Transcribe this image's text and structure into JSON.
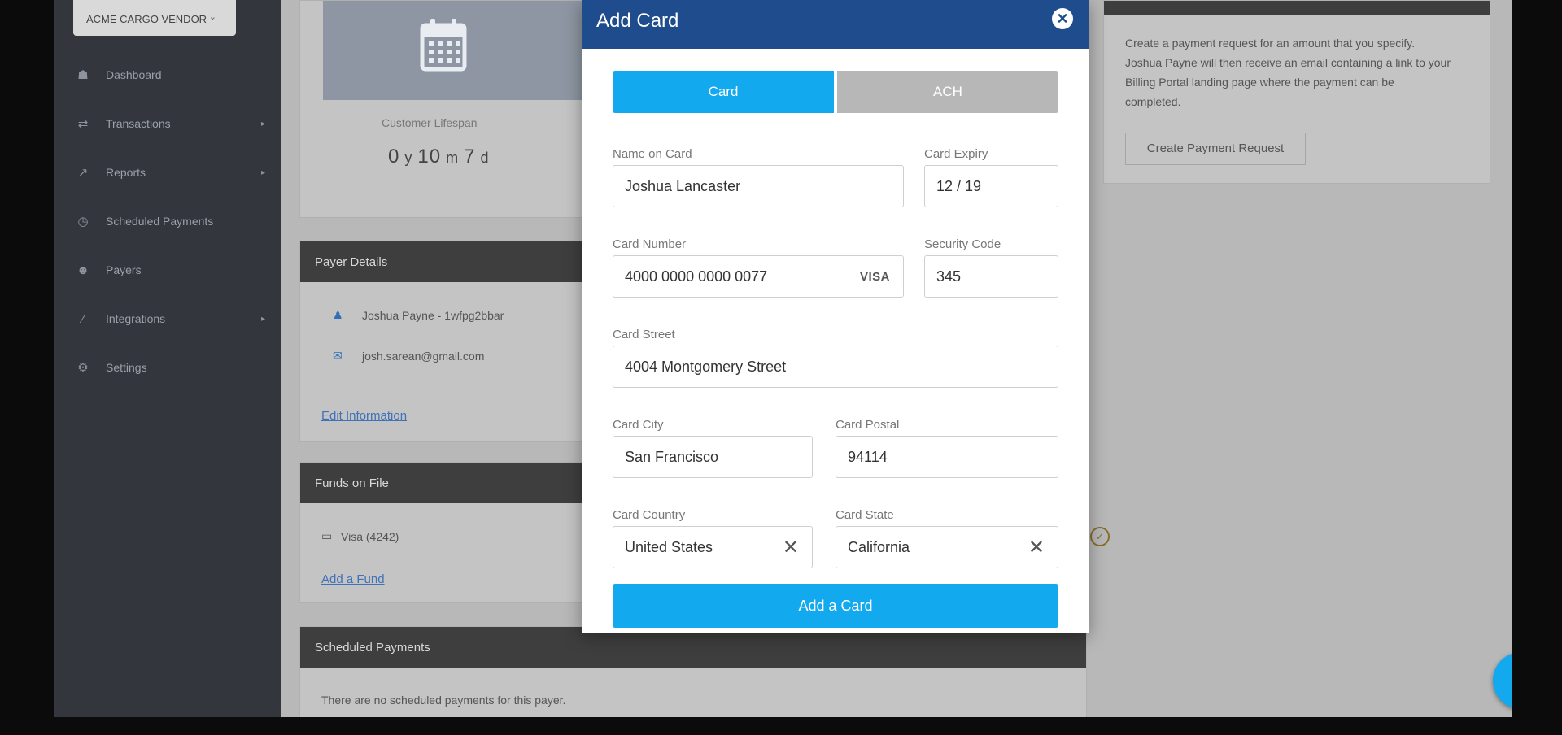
{
  "sidebar": {
    "vendor": "ACME CARGO VENDOR",
    "items": [
      {
        "label": "Dashboard",
        "icon": "dashboard-icon",
        "glyph": "☗",
        "arrow": false
      },
      {
        "label": "Transactions",
        "icon": "transactions-icon",
        "glyph": "⇄",
        "arrow": true
      },
      {
        "label": "Reports",
        "icon": "reports-icon",
        "glyph": "↗",
        "arrow": true
      },
      {
        "label": "Scheduled Payments",
        "icon": "clock-icon",
        "glyph": "◷",
        "arrow": false
      },
      {
        "label": "Payers",
        "icon": "payers-icon",
        "glyph": "☻",
        "arrow": false
      },
      {
        "label": "Integrations",
        "icon": "integrations-icon",
        "glyph": "⁄",
        "arrow": true
      },
      {
        "label": "Settings",
        "icon": "settings-icon",
        "glyph": "⚙",
        "arrow": false
      }
    ]
  },
  "main": {
    "lifespan_label": "Customer Lifespan",
    "lifespan_y": "0",
    "lifespan_m": "10",
    "lifespan_d": "7",
    "payer_details": {
      "title": "Payer Details",
      "name": "Joshua Payne - 1wfpg2bbar",
      "email": "josh.sarean@gmail.com",
      "edit_link": "Edit Information"
    },
    "funds": {
      "title": "Funds on File",
      "card": "Visa (4242)",
      "add_link": "Add a Fund"
    },
    "scheduled": {
      "title": "Scheduled Payments",
      "empty": "There are no scheduled payments for this payer."
    }
  },
  "request_panel": {
    "text": "Create a payment request for an amount that you specify. Joshua Payne will then receive an email containing a link to your Billing Portal landing page where the payment can be completed.",
    "button": "Create Payment Request"
  },
  "modal": {
    "title": "Add Card",
    "tabs": [
      "Card",
      "ACH"
    ],
    "active_tab": "Card",
    "fields": {
      "name_label": "Name on Card",
      "name_value": "Joshua Lancaster",
      "expiry_label": "Card Expiry",
      "expiry_value": "12 / 19",
      "number_label": "Card Number",
      "number_value": "4000 0000 0000 0077",
      "brand": "VISA",
      "cvc_label": "Security Code",
      "cvc_value": "345",
      "street_label": "Card Street",
      "street_value": "4004 Montgomery Street",
      "city_label": "Card City",
      "city_value": "San Francisco",
      "postal_label": "Card Postal",
      "postal_value": "94114",
      "country_label": "Card Country",
      "country_value": "United States",
      "state_label": "Card State",
      "state_value": "California"
    },
    "submit": "Add a Card"
  },
  "fab_label": "+",
  "colors": {
    "accent": "#12a9ef",
    "modal_header": "#1e4c8c",
    "sidebar": "#33363d"
  }
}
